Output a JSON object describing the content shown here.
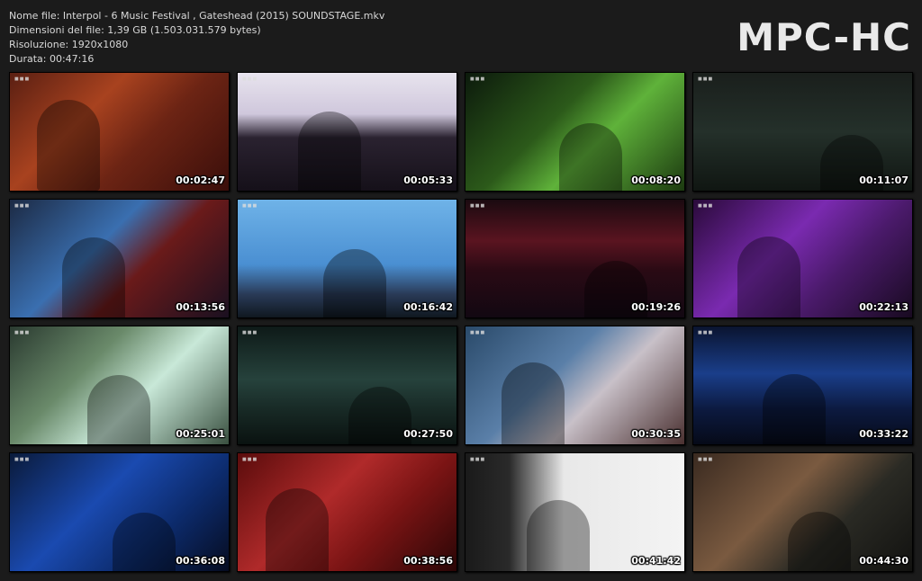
{
  "info": {
    "filename": "Nome file: Interpol - 6 Music Festival , Gateshead (2015) SOUNDSTAGE.mkv",
    "filesize": "Dimensioni del file: 1,39 GB (1.503.031.579 bytes)",
    "resolution": "Risoluzione: 1920x1080",
    "duration": "Durata: 00:47:16"
  },
  "brand": "MPC-HC",
  "thumbnails": [
    {
      "timestamp": "00:02:47",
      "bg": "linear-gradient(135deg,#5a1f12 0%,#a8421f 35%,#6c2414 60%,#3a0e0a 100%)"
    },
    {
      "timestamp": "00:05:33",
      "bg": "linear-gradient(180deg,#e8e4ee 0%,#cfc7dc 35%,#2a2230 55%,#151019 100%)"
    },
    {
      "timestamp": "00:08:20",
      "bg": "linear-gradient(135deg,#0c1a0c 0%,#2c5a1a 40%,#5fb23a 60%,#1c3a10 100%)"
    },
    {
      "timestamp": "00:11:07",
      "bg": "linear-gradient(180deg,#1a1f1c 0%,#24302a 50%,#101612 100%)"
    },
    {
      "timestamp": "00:13:56",
      "bg": "linear-gradient(135deg,#1c2a44 0%,#3a6fb0 40%,#6a1a1a 60%,#1a1020 100%)"
    },
    {
      "timestamp": "00:16:42",
      "bg": "linear-gradient(180deg,#6fb3e8 0%,#4a8fd2 55%,#2a3b58 80%,#101820 100%)"
    },
    {
      "timestamp": "00:19:26",
      "bg": "linear-gradient(180deg,#1a0a10 0%,#5a1420 35%,#2a0a14 60%,#120812 100%)"
    },
    {
      "timestamp": "00:22:13",
      "bg": "linear-gradient(135deg,#2a0a3a 0%,#7a2ab0 40%,#4a1a6a 65%,#180a20 100%)"
    },
    {
      "timestamp": "00:25:01",
      "bg": "linear-gradient(135deg,#2a3a30 0%,#6a8a6a 35%,#c8e8d8 60%,#3a5040 100%)"
    },
    {
      "timestamp": "00:27:50",
      "bg": "linear-gradient(180deg,#0e1a18 0%,#26423c 45%,#182a26 70%,#0a1210 100%)"
    },
    {
      "timestamp": "00:30:35",
      "bg": "linear-gradient(135deg,#2a4a6a 0%,#5a7fa8 40%,#c8c0c8 60%,#4a3030 100%)"
    },
    {
      "timestamp": "00:33:22",
      "bg": "linear-gradient(180deg,#0a1430 0%,#1a3e8a 40%,#0c1a40 70%,#060a18 100%)"
    },
    {
      "timestamp": "00:36:08",
      "bg": "linear-gradient(135deg,#0a1a3a 0%,#1a4ab0 40%,#0c2a6a 70%,#060c20 100%)"
    },
    {
      "timestamp": "00:38:56",
      "bg": "linear-gradient(135deg,#5a0c0c 0%,#b02a2a 40%,#7a1414 65%,#2a0606 100%)"
    },
    {
      "timestamp": "00:41:42",
      "bg": "linear-gradient(90deg,#1a1a1a 0%,#2a2a2a 20%,#e8e8e8 45%,#f4f4f4 100%)"
    },
    {
      "timestamp": "00:44:30",
      "bg": "linear-gradient(135deg,#3a2a20 0%,#7a5a40 40%,#2a2a24 65%,#121210 100%)"
    }
  ]
}
